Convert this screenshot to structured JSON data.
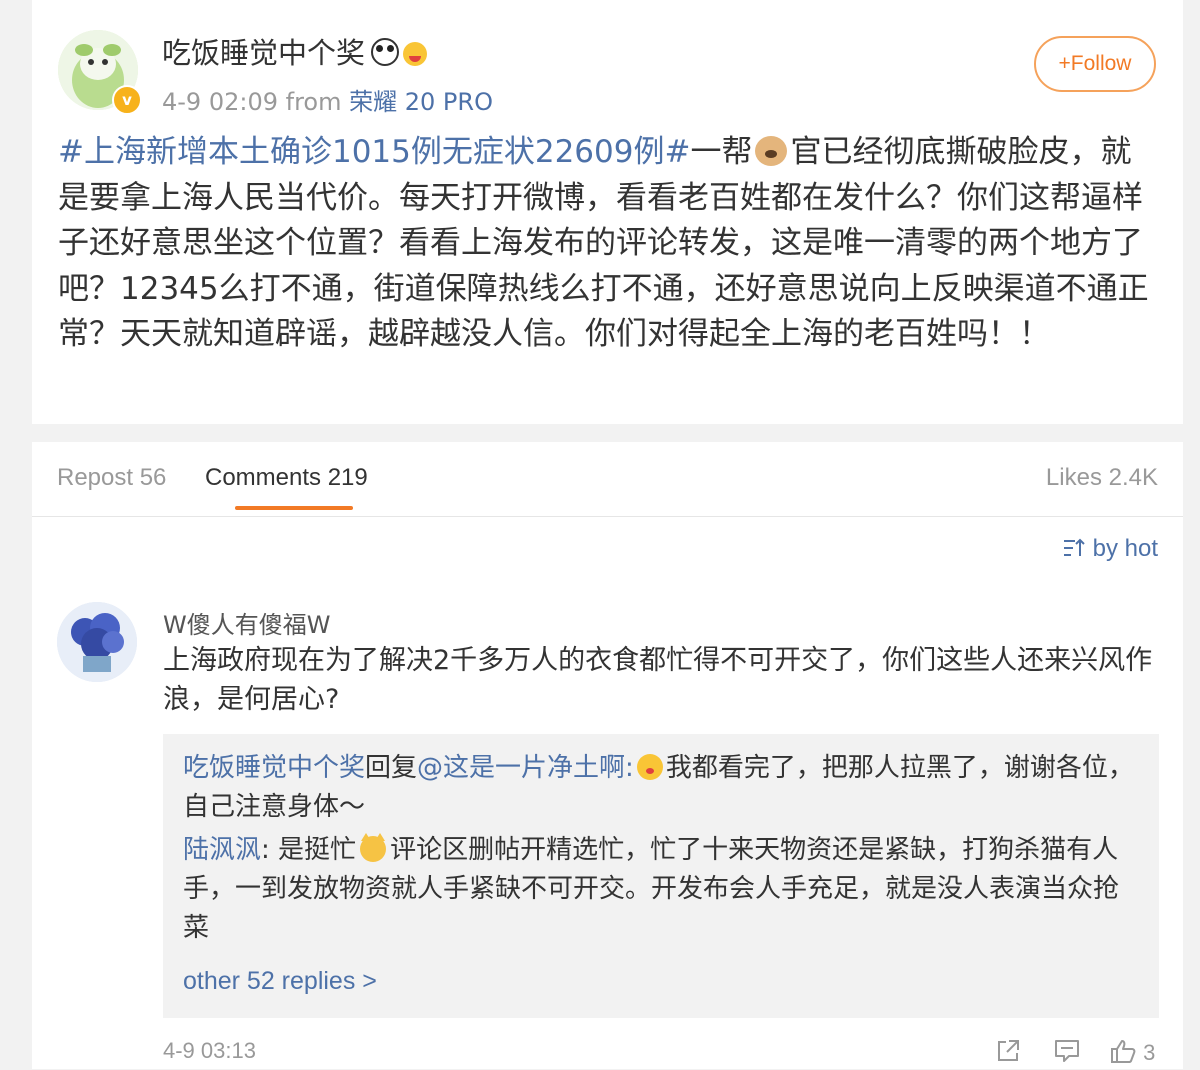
{
  "post": {
    "username": "吃饭睡觉中个奖",
    "verified_badge": "v",
    "time": "4-9 02:09",
    "from_label": "from",
    "device": "荣耀 20 PRO",
    "follow_label": "+Follow",
    "hashtag": "#上海新增本土确诊1015例无症状22609例#",
    "text_part1": "一帮",
    "text_part2": "官已经彻底撕破脸皮，就是要拿上海人民当代价。每天打开微博，看看老百姓都在发什么？你们这帮逼样子还好意思坐这个位置？看看上海发布的评论转发，这是唯一清零的两个地方了吧？12345么打不通，街道保障热线么打不通，还好意思说向上反映渠道不通正常？天天就知道辟谣，越辟越没人信。你们对得起全上海的老百姓吗！！"
  },
  "tabs": {
    "repost": "Repost 56",
    "comments": "Comments 219",
    "likes": "Likes 2.4K"
  },
  "sort": {
    "label": "by hot"
  },
  "comment": {
    "username": "W傻人有傻福W",
    "text": "上海政府现在为了解决2千多万人的衣食都忙得不可开交了，你们这些人还来兴风作浪，是何居心?",
    "time": "4-9 03:13",
    "like_count": "3",
    "replies": [
      {
        "name": "吃饭睡觉中个奖",
        "reply_word": "回复",
        "mention": "@这是一片净土啊",
        "colon": ":",
        "text": "我都看完了，把那人拉黑了，谢谢各位，自己注意身体～"
      },
      {
        "name": "陆沨沨",
        "colon": ": ",
        "text_part1": "是挺忙",
        "text_part2": "评论区删帖开精选忙，忙了十来天物资还是紧缺，打狗杀猫有人手，一到发放物资就人手紧缺不可开交。开发布会人手充足，就是没人表演当众抢菜"
      }
    ],
    "more_replies": "other 52 replies >"
  },
  "colors": {
    "link_blue": "#4d71a8",
    "accent_orange": "#f27a25",
    "background": "#f2f2f2",
    "muted_text": "#999999"
  }
}
